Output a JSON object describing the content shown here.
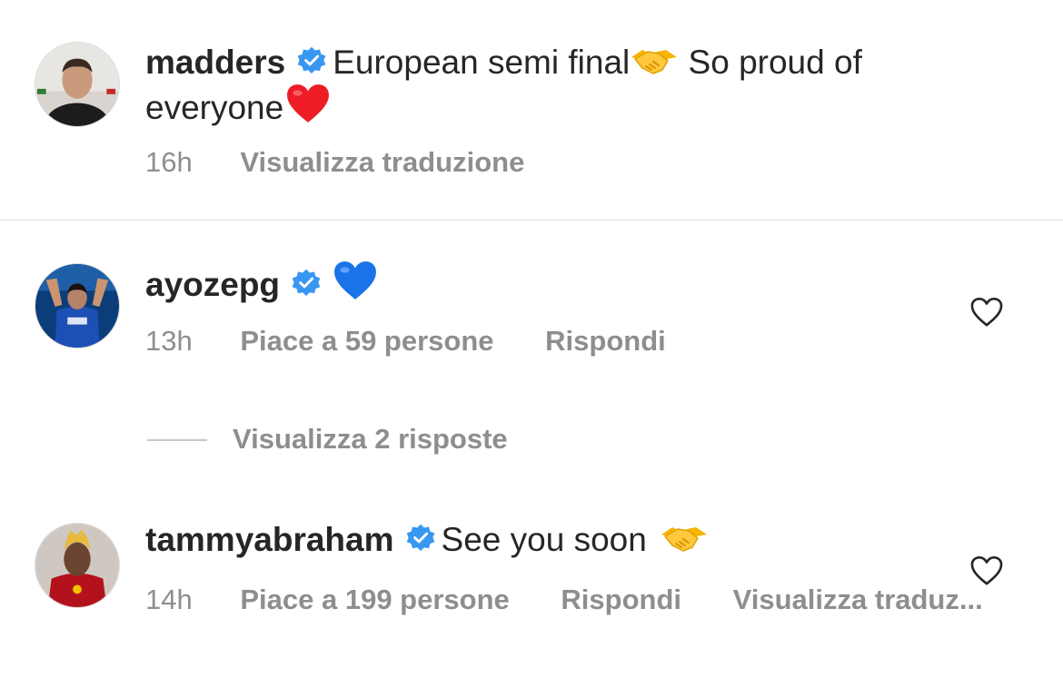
{
  "comments": [
    {
      "username": "madders",
      "text_part1": "European semi final",
      "text_part2": " So proud of",
      "text_line2": "everyone",
      "time": "16h",
      "translate": "Visualizza traduzione",
      "emoji_1": "handshake-emoji",
      "emoji_2": "red-heart-emoji"
    },
    {
      "username": "ayozepg",
      "time": "13h",
      "likes": "Piace a 59 persone",
      "reply": "Rispondi",
      "view_replies": "Visualizza 2 risposte",
      "emoji_1": "blue-heart-emoji"
    },
    {
      "username": "tammyabraham",
      "text": "See you soon ",
      "time": "14h",
      "likes": "Piace a 199 persone",
      "reply": "Rispondi",
      "translate": "Visualizza traduz...",
      "emoji_1": "handshake-emoji"
    }
  ],
  "colors": {
    "text": "#262626",
    "secondary": "#8e8e8e",
    "verified": "#3897f0",
    "divider": "#dbdbdb"
  }
}
